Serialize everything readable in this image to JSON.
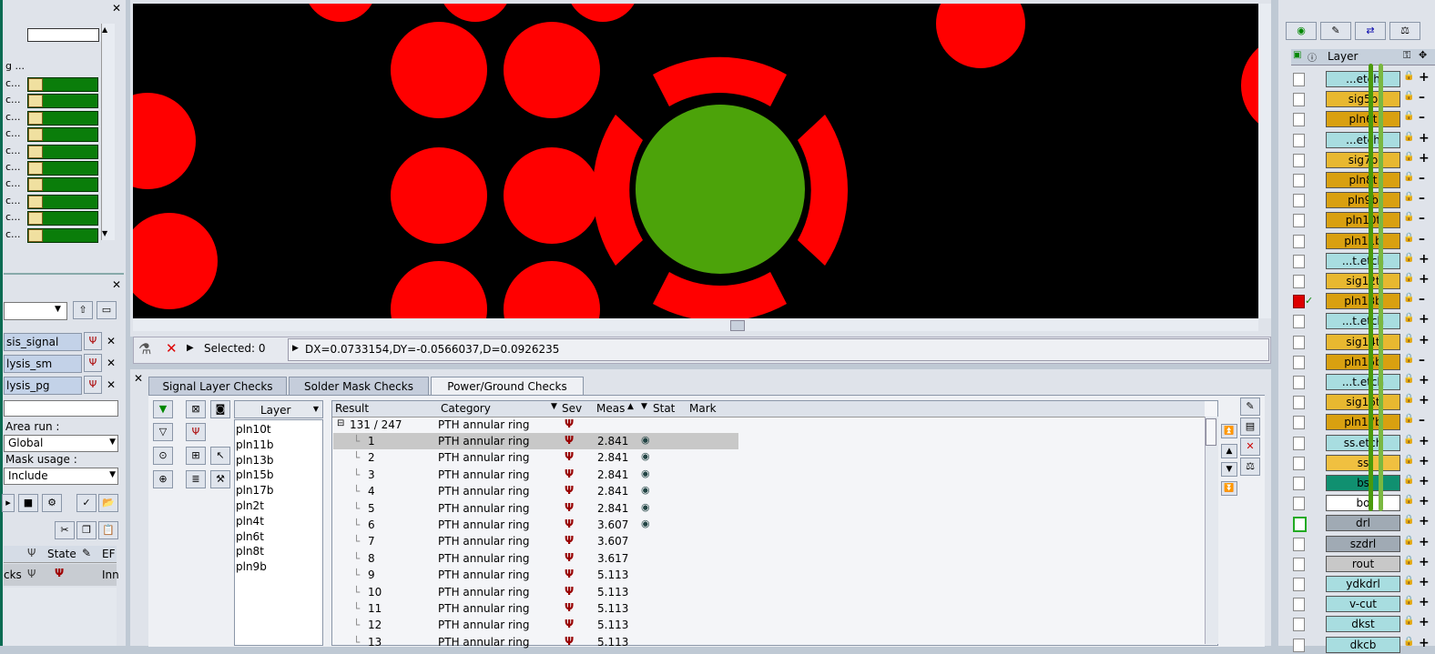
{
  "left_panel": {
    "list_rows": [
      "c...",
      "c...",
      "c...",
      "c...",
      "c...",
      "c...",
      "c...",
      "c...",
      "c...",
      "c..."
    ],
    "row_top": "g ...",
    "analysis_items": [
      {
        "label": "sis_signal"
      },
      {
        "label": "lysis_sm"
      },
      {
        "label": "lysis_pg"
      }
    ],
    "area_run_label": "Area run :",
    "area_run_value": "Global",
    "mask_usage_label": "Mask usage :",
    "mask_usage_value": "Include",
    "table_headers": {
      "state": "State",
      "er": "EF"
    },
    "table_row": {
      "name": "cks",
      "value": "Inn"
    }
  },
  "canvas": {
    "background": "#000000",
    "pad_color": "#ff0000",
    "selected_pad_color": "#4ca30a"
  },
  "status_bar": {
    "selected_label": "Selected: 0",
    "measurement": "DX=0.0733154,DY=-0.0566037,D=0.0926235"
  },
  "tabs": [
    "Signal Layer Checks",
    "Solder Mask Checks",
    "Power/Ground Checks"
  ],
  "layer_list": {
    "header": "Layer",
    "items": [
      "pln10t",
      "pln11b",
      "pln13b",
      "pln15b",
      "pln17b",
      "pln2t",
      "pln4t",
      "pln6t",
      "pln8t",
      "pln9b"
    ]
  },
  "results": {
    "headers": {
      "result": "Result",
      "category": "Category",
      "sev": "Sev",
      "meas": "Meas",
      "stat": "Stat",
      "mark": "Mark"
    },
    "group": {
      "label": "131 / 247",
      "category": "PTH annular ring"
    },
    "rows": [
      {
        "id": "1",
        "category": "PTH annular ring",
        "meas": "2.841",
        "stat": true
      },
      {
        "id": "2",
        "category": "PTH annular ring",
        "meas": "2.841",
        "stat": true
      },
      {
        "id": "3",
        "category": "PTH annular ring",
        "meas": "2.841",
        "stat": true
      },
      {
        "id": "4",
        "category": "PTH annular ring",
        "meas": "2.841",
        "stat": true
      },
      {
        "id": "5",
        "category": "PTH annular ring",
        "meas": "2.841",
        "stat": true
      },
      {
        "id": "6",
        "category": "PTH annular ring",
        "meas": "3.607",
        "stat": true
      },
      {
        "id": "7",
        "category": "PTH annular ring",
        "meas": "3.607",
        "stat": false
      },
      {
        "id": "8",
        "category": "PTH annular ring",
        "meas": "3.617",
        "stat": false
      },
      {
        "id": "9",
        "category": "PTH annular ring",
        "meas": "5.113",
        "stat": false
      },
      {
        "id": "10",
        "category": "PTH annular ring",
        "meas": "5.113",
        "stat": false
      },
      {
        "id": "11",
        "category": "PTH annular ring",
        "meas": "5.113",
        "stat": false
      },
      {
        "id": "12",
        "category": "PTH annular ring",
        "meas": "5.113",
        "stat": false
      },
      {
        "id": "13",
        "category": "PTH annular ring",
        "meas": "5.113",
        "stat": false
      }
    ]
  },
  "right_panel": {
    "layer_header": "Layer",
    "layers": [
      {
        "name": "...etch",
        "color": "#a8dde0"
      },
      {
        "name": "sig5b",
        "color": "#e8b830"
      },
      {
        "name": "pln6t",
        "color": "#d9a010"
      },
      {
        "name": "...etch",
        "color": "#a8dde0"
      },
      {
        "name": "sig7b",
        "color": "#e8b830"
      },
      {
        "name": "pln8t",
        "color": "#d9a010"
      },
      {
        "name": "pln9b",
        "color": "#d9a010"
      },
      {
        "name": "pln10t",
        "color": "#d9a010"
      },
      {
        "name": "pln11b",
        "color": "#d9a010"
      },
      {
        "name": "...t.etch",
        "color": "#a8dde0"
      },
      {
        "name": "sig12t",
        "color": "#e8b830"
      },
      {
        "name": "pln13b",
        "color": "#d9a010"
      },
      {
        "name": "...t.etch",
        "color": "#a8dde0"
      },
      {
        "name": "sig14t",
        "color": "#e8b830"
      },
      {
        "name": "pln15b",
        "color": "#d9a010"
      },
      {
        "name": "...t.etch",
        "color": "#a8dde0"
      },
      {
        "name": "sig16t",
        "color": "#e8b830"
      },
      {
        "name": "pln17b",
        "color": "#d9a010"
      },
      {
        "name": "ss.etch",
        "color": "#a8dde0"
      },
      {
        "name": "ss",
        "color": "#f0c040"
      },
      {
        "name": "bs",
        "color": "#109070"
      },
      {
        "name": "bo",
        "color": "#ffffff"
      },
      {
        "name": "drl",
        "color": "#a0aab4"
      },
      {
        "name": "szdrl",
        "color": "#a0aab4"
      },
      {
        "name": "rout",
        "color": "#c8c8c8"
      },
      {
        "name": "ydkdrl",
        "color": "#a8dde0"
      },
      {
        "name": "v-cut",
        "color": "#a8dde0"
      },
      {
        "name": "dkst",
        "color": "#a8dde0"
      },
      {
        "name": "dkcb",
        "color": "#a8dde0"
      }
    ]
  }
}
